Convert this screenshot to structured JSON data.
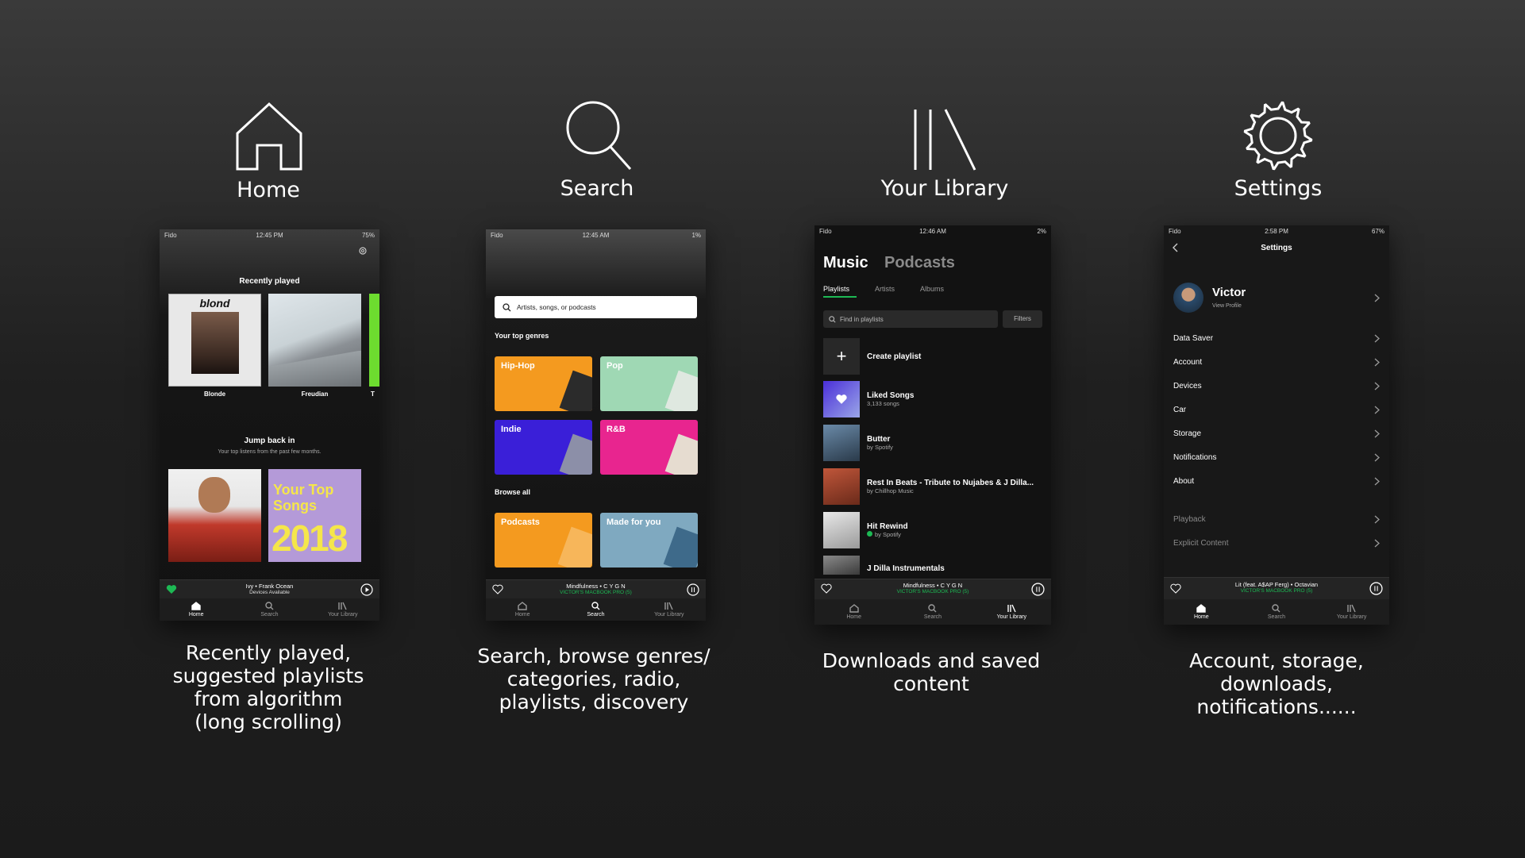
{
  "columns": [
    {
      "title": "Home",
      "icon": "home-icon",
      "caption": [
        "Recently played,",
        "suggested playlists",
        "from algorithm",
        "(long scrolling)"
      ]
    },
    {
      "title": "Search",
      "icon": "search-icon",
      "caption": [
        "Search, browse genres/",
        "categories, radio,",
        "playlists, discovery"
      ]
    },
    {
      "title": "Your Library",
      "icon": "library-icon",
      "caption": [
        "Downloads and saved",
        "content"
      ]
    },
    {
      "title": "Settings",
      "icon": "gear-icon",
      "caption": [
        "Account, storage,",
        "downloads,",
        "notifications......"
      ]
    }
  ],
  "tabs": {
    "home": "Home",
    "search": "Search",
    "library": "Your Library"
  },
  "home": {
    "status": {
      "carrier": "Fido",
      "time": "12:45 PM",
      "battery": "75%"
    },
    "recently_played": "Recently played",
    "items": [
      {
        "title": "Blonde",
        "art_text": "blond"
      },
      {
        "title": "Freudian"
      },
      {
        "title": "T"
      }
    ],
    "jump_back": "Jump back in",
    "jump_sub": "Your top listens from the past few months.",
    "top_songs_art": [
      "Your Top",
      "Songs",
      "2018"
    ],
    "player": {
      "track": "Ivy • Frank Ocean",
      "device": "Devices Available"
    }
  },
  "search": {
    "status": {
      "carrier": "Fido",
      "time": "12:45 AM",
      "battery": "1%"
    },
    "placeholder": "Artists, songs, or podcasts",
    "top_genres": "Your top genres",
    "genres": [
      "Hip-Hop",
      "Pop",
      "Indie",
      "R&B"
    ],
    "browse_all": "Browse all",
    "browse": [
      "Podcasts",
      "Made for you"
    ],
    "player": {
      "track": "Mindfulness • C Y G N",
      "device": "VICTOR'S MACBOOK PRO (5)"
    }
  },
  "library": {
    "status": {
      "carrier": "Fido",
      "time": "12:46 AM",
      "battery": "2%"
    },
    "music": "Music",
    "podcasts": "Podcasts",
    "subtabs": [
      "Playlists",
      "Artists",
      "Albums"
    ],
    "find": "Find in playlists",
    "filters": "Filters",
    "create": "Create playlist",
    "rows": [
      {
        "title": "Liked Songs",
        "sub": "3,133 songs"
      },
      {
        "title": "Butter",
        "sub": "by Spotify"
      },
      {
        "title": "Rest In Beats - Tribute to Nujabes & J Dilla...",
        "sub": "by Chillhop Music"
      },
      {
        "title": "Hit Rewind",
        "sub": "by Spotify"
      },
      {
        "title": "J Dilla Instrumentals",
        "sub": ""
      }
    ],
    "player": {
      "track": "Mindfulness • C Y G N",
      "device": "VICTOR'S MACBOOK PRO (5)"
    }
  },
  "settings": {
    "status": {
      "carrier": "Fido",
      "time": "2:58 PM",
      "battery": "67%"
    },
    "title": "Settings",
    "name": "Victor",
    "view_profile": "View Profile",
    "items": [
      "Data Saver",
      "Account",
      "Devices",
      "Car",
      "Storage",
      "Notifications",
      "About"
    ],
    "dim_items": [
      "Playback",
      "Explicit Content"
    ],
    "player": {
      "track": "Lit (feat. A$AP Ferg) • Octavian",
      "device": "VICTOR'S MACBOOK PRO (5)"
    }
  },
  "colors": {
    "accent": "#1db954",
    "hiphop": "#f49a1f",
    "pop": "#9fd8b4",
    "indie": "#3a1fd8",
    "rnb": "#e8258f",
    "podcasts": "#f49a1f",
    "madeforyou": "#7fa9c0"
  }
}
